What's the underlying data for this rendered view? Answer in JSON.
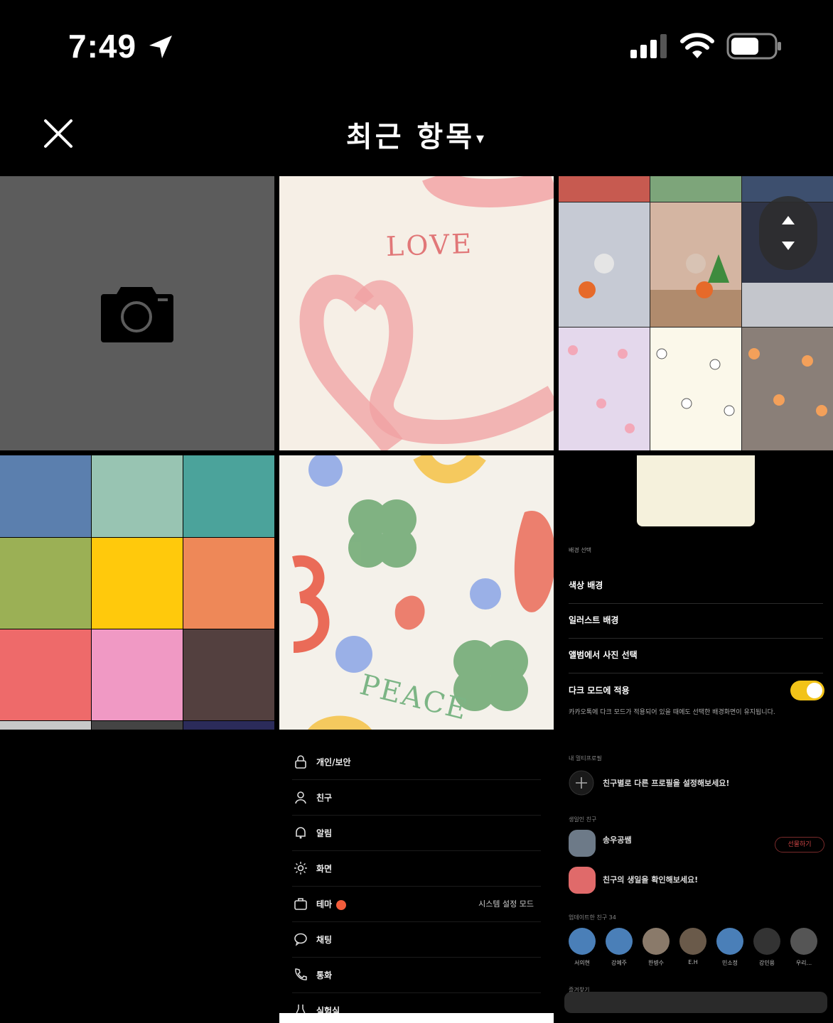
{
  "status_bar": {
    "time": "7:49"
  },
  "header": {
    "title": "최근 항목",
    "title_caret": "▾"
  },
  "grid": {
    "love_text": "LOVE",
    "peace_text": "PEACE",
    "palette_colors": [
      "#5b7fae",
      "#98c4b2",
      "#4ba39b",
      "#9bb055",
      "#ffc90c",
      "#ee8858",
      "#ee6a6a",
      "#f099c4",
      "#53403f"
    ]
  },
  "settings_shot": {
    "section": "배경 선택",
    "items": [
      "색상 배경",
      "일러스트 배경",
      "앨범에서 사진 선택",
      "다크 모드에 적용"
    ],
    "desc": "카카오톡에 다크 모드가 적용되어 있을 때에도 선택한 배경화면이 유지됩니다."
  },
  "menu_shot": {
    "items": [
      {
        "label": "개인/보안",
        "icon": "lock-icon"
      },
      {
        "label": "친구",
        "icon": "person-icon"
      },
      {
        "label": "알림",
        "icon": "bell-icon"
      },
      {
        "label": "화면",
        "icon": "sun-icon"
      },
      {
        "label": "테마",
        "icon": "theme-icon",
        "badge": "N",
        "value": "시스템 설정 모드"
      },
      {
        "label": "채팅",
        "icon": "chat-icon"
      },
      {
        "label": "통화",
        "icon": "phone-icon"
      },
      {
        "label": "실험실",
        "icon": "flask-icon"
      }
    ]
  },
  "friends_shot": {
    "multi_profile_section": "내 멀티프로필",
    "multi_profile_prompt": "친구별로 다른 프로필을 설정해보세요!",
    "birthday_section": "생일인 친구",
    "birthday_friend": "송우공쌤",
    "gift_button": "선물하기",
    "birthday_prompt": "친구의 생일을 확인해보세요!",
    "updated_section": "업데이트한 친구 34",
    "updated_friends": [
      "서의현",
      "강예주",
      "한병수",
      "E.H",
      "민소정",
      "강민용",
      "우리..."
    ],
    "favorites_section": "즐겨찾기"
  }
}
